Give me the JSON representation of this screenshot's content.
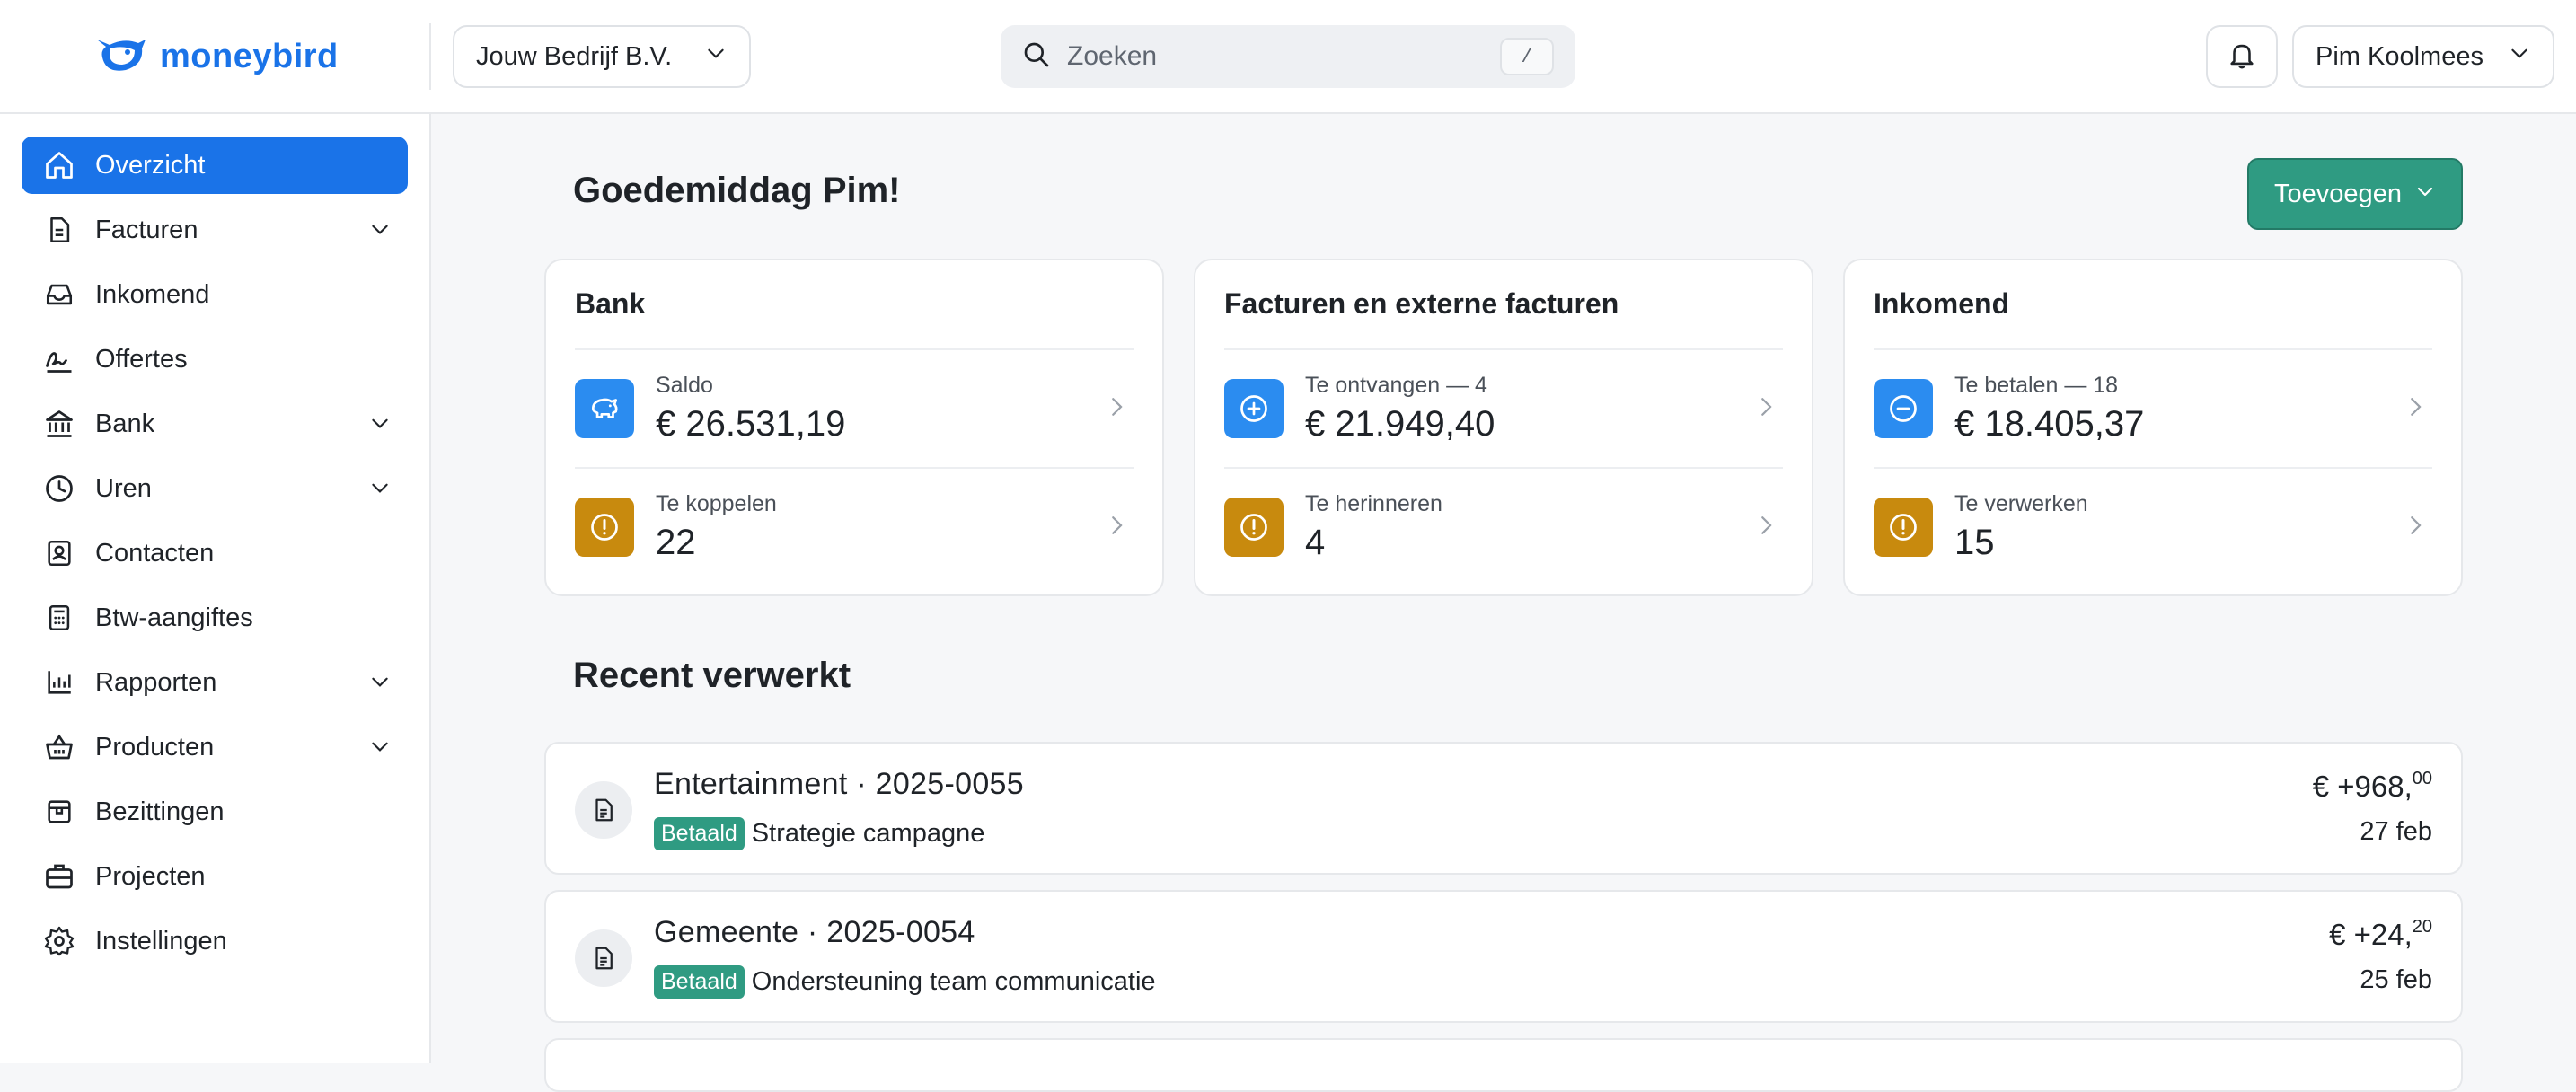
{
  "header": {
    "logo_text": "moneybird",
    "company": "Jouw Bedrijf B.V.",
    "search": {
      "placeholder": "Zoeken",
      "shortcut": "/"
    },
    "user": "Pim Koolmees"
  },
  "sidebar": {
    "items": [
      {
        "label": "Overzicht",
        "icon": "home-icon",
        "active": true,
        "expandable": false
      },
      {
        "label": "Facturen",
        "icon": "document-icon",
        "expandable": true
      },
      {
        "label": "Inkomend",
        "icon": "inbox-icon",
        "expandable": false
      },
      {
        "label": "Offertes",
        "icon": "signature-icon",
        "expandable": false
      },
      {
        "label": "Bank",
        "icon": "bank-icon",
        "expandable": true
      },
      {
        "label": "Uren",
        "icon": "clock-icon",
        "expandable": true
      },
      {
        "label": "Contacten",
        "icon": "contact-icon",
        "expandable": false
      },
      {
        "label": "Btw-aangiftes",
        "icon": "calculator-icon",
        "expandable": false
      },
      {
        "label": "Rapporten",
        "icon": "chart-icon",
        "expandable": true
      },
      {
        "label": "Producten",
        "icon": "basket-icon",
        "expandable": true
      },
      {
        "label": "Bezittingen",
        "icon": "box-icon",
        "expandable": false
      },
      {
        "label": "Projecten",
        "icon": "briefcase-icon",
        "expandable": false
      },
      {
        "label": "Instellingen",
        "icon": "gear-icon",
        "expandable": false
      }
    ]
  },
  "main": {
    "greeting": "Goedemiddag Pim!",
    "add_button": "Toevoegen",
    "cards": [
      {
        "title": "Bank",
        "rows": [
          {
            "label": "Saldo",
            "value": "€ 26.531,19",
            "icon": "piggy-bank-icon",
            "color": "#2b8cf0"
          },
          {
            "label": "Te koppelen",
            "value": "22",
            "icon": "alert-icon",
            "color": "#c88a0e"
          }
        ]
      },
      {
        "title": "Facturen en externe facturen",
        "rows": [
          {
            "label": "Te ontvangen — 4",
            "value": "€ 21.949,40",
            "icon": "plus-circle-icon",
            "color": "#2b8cf0"
          },
          {
            "label": "Te herinneren",
            "value": "4",
            "icon": "alert-icon",
            "color": "#c88a0e"
          }
        ]
      },
      {
        "title": "Inkomend",
        "rows": [
          {
            "label": "Te betalen — 18",
            "value": "€ 18.405,37",
            "icon": "minus-circle-icon",
            "color": "#2b8cf0"
          },
          {
            "label": "Te verwerken",
            "value": "15",
            "icon": "alert-icon",
            "color": "#c88a0e"
          }
        ]
      }
    ],
    "recent_title": "Recent verwerkt",
    "recent": [
      {
        "title": "Entertainment · 2025-0055",
        "status": "Betaald",
        "description": "Strategie campagne",
        "amount_main": "€ +968,",
        "amount_cents": "00",
        "date": "27 feb"
      },
      {
        "title": "Gemeente · 2025-0054",
        "status": "Betaald",
        "description": "Ondersteuning team communicatie",
        "amount_main": "€ +24,",
        "amount_cents": "20",
        "date": "25 feb"
      }
    ]
  },
  "colors": {
    "primary": "#1a73e8",
    "success": "#2f9b82",
    "info": "#2b8cf0",
    "warning": "#c88a0e"
  }
}
